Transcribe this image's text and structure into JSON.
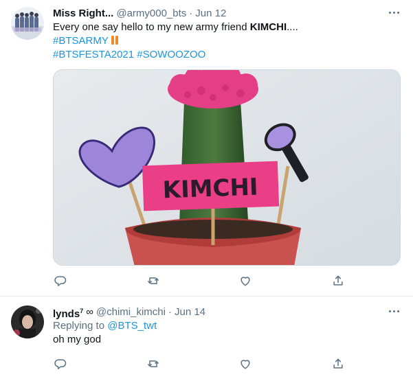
{
  "tweets": [
    {
      "display_name": "Miss Right...",
      "handle": "@army000_bts",
      "separator": "·",
      "date": "Jun 12",
      "text_prefix": "Every one say hello to my new army friend ",
      "text_bold": "KIMCHI",
      "text_suffix": "....",
      "hashtags_line1": "#BTSARMY",
      "hashtags_line2": "#BTSFESTA2021 #SOWOOZOO",
      "media_sign_text": "KIMCHI",
      "media_alt": "cactus in pot with heart and lightstick picks"
    },
    {
      "display_name": "lynds",
      "superscript": "7",
      "infinity": "∞",
      "handle": "@chimi_kimchi",
      "separator": "·",
      "date": "Jun 14",
      "replying_to_label": "Replying to ",
      "replying_to_handle": "@BTS_twt",
      "text": "oh my god"
    }
  ],
  "actions": [
    "reply-icon",
    "retweet-icon",
    "like-icon",
    "share-icon"
  ],
  "colors": {
    "text": "#0f1419",
    "secondary": "#5b7083",
    "link": "#1b95e0",
    "border": "#e6ecf0",
    "pot": "#c9514e",
    "sign": "#ea3f86"
  }
}
